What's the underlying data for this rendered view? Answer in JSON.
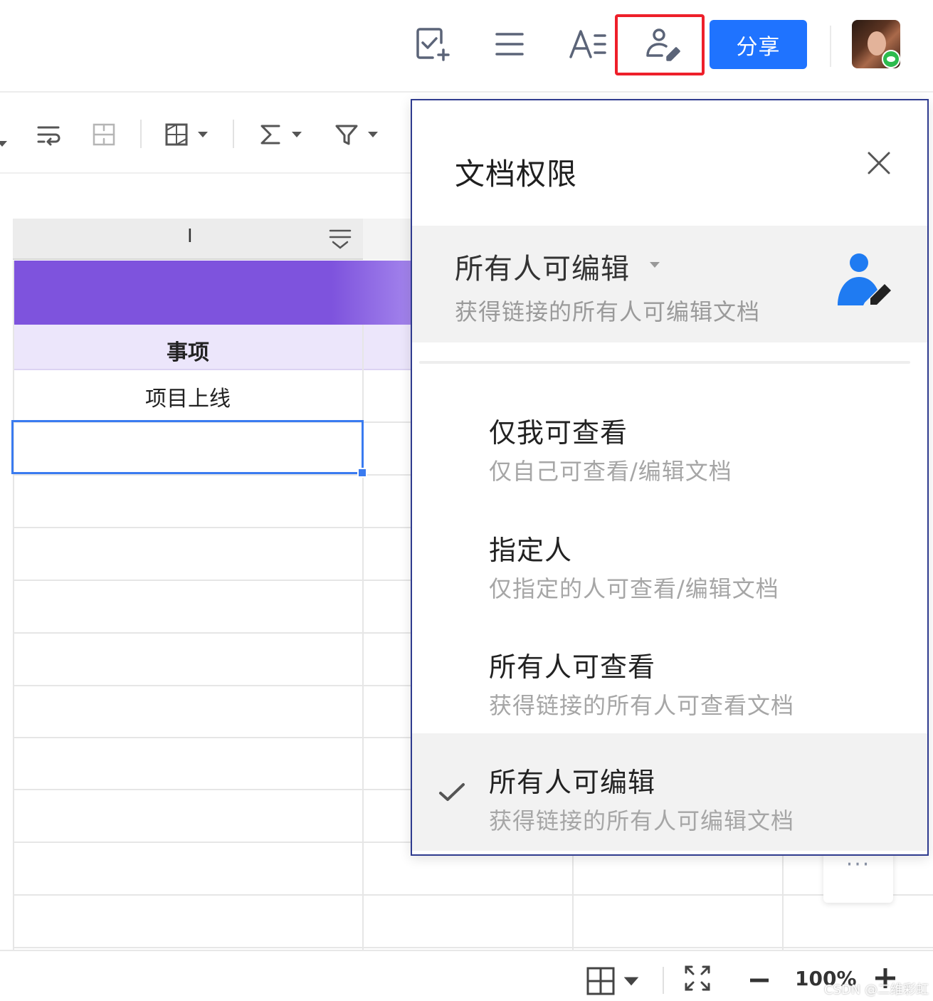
{
  "topbar": {
    "icons": [
      "add-task-icon",
      "list-icon",
      "text-format-icon",
      "permission-icon"
    ],
    "share_label": "分享",
    "highlight_color": "#ee1f2a",
    "accent_color": "#1f73ff"
  },
  "toolbar": {
    "icons": [
      "wrap-text-icon",
      "merge-cells-icon",
      "borders-icon",
      "sum-icon",
      "filter-icon"
    ]
  },
  "sheet": {
    "column_letter": "I",
    "header_cell": "事项",
    "rows": [
      "项目上线",
      ""
    ],
    "more_label": "···",
    "band_color": "#7e53dd"
  },
  "permission_panel": {
    "title": "文档权限",
    "current": {
      "label": "所有人可编辑",
      "description": "获得链接的所有人可编辑文档"
    },
    "options": [
      {
        "label": "仅我可查看",
        "description": "仅自己可查看/编辑文档",
        "selected": false
      },
      {
        "label": "指定人",
        "description": "仅指定的人可查看/编辑文档",
        "selected": false
      },
      {
        "label": "所有人可查看",
        "description": "获得链接的所有人可查看文档",
        "selected": false
      },
      {
        "label": "所有人可编辑",
        "description": "获得链接的所有人可编辑文档",
        "selected": true
      }
    ]
  },
  "statusbar": {
    "zoom": "100%",
    "watermark": "CSDN @二维彩虹"
  }
}
